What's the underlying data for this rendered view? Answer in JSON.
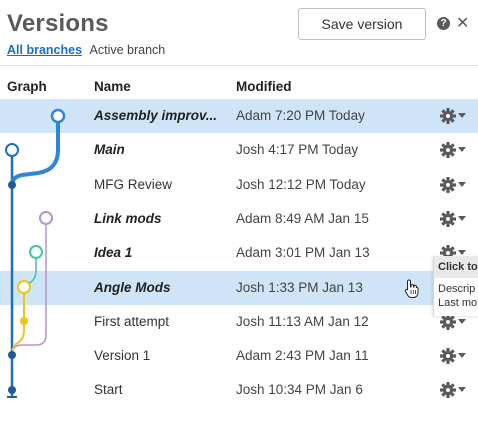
{
  "header": {
    "title": "Versions",
    "save_label": "Save version",
    "help_glyph": "?",
    "close_glyph": "✕"
  },
  "tabs": {
    "all": "All branches",
    "active": "Active branch"
  },
  "columns": {
    "graph": "Graph",
    "name": "Name",
    "modified": "Modified"
  },
  "rows": [
    {
      "name": "Assembly improv...",
      "modified": "Adam 7:20 PM Today",
      "emphasis": true,
      "selected": true
    },
    {
      "name": "Main",
      "modified": "Josh 4:17 PM Today",
      "emphasis": true,
      "selected": false
    },
    {
      "name": "MFG Review",
      "modified": "Josh 12:12 PM Today",
      "emphasis": false,
      "selected": false
    },
    {
      "name": "Link mods",
      "modified": "Adam 8:49 AM Jan 15",
      "emphasis": true,
      "selected": false
    },
    {
      "name": "Idea 1",
      "modified": "Adam 3:01 PM Jan 13",
      "emphasis": true,
      "selected": false
    },
    {
      "name": "Angle Mods",
      "modified": "Josh 1:33 PM Jan 13",
      "emphasis": true,
      "selected": true
    },
    {
      "name": "First attempt",
      "modified": "Josh 11:13 AM Jan 12",
      "emphasis": false,
      "selected": false
    },
    {
      "name": "Version 1",
      "modified": "Adam 2:43 PM Jan 11",
      "emphasis": false,
      "selected": false
    },
    {
      "name": "Start",
      "modified": "Josh 10:34 PM Jan 6",
      "emphasis": false,
      "selected": false
    }
  ],
  "tooltip": {
    "title": "Click to",
    "line1": "Descrip",
    "line2": "Last mo"
  },
  "icons": {
    "row_menu": "gear-icon",
    "cursor": "hand-pointer-icon"
  },
  "colors": {
    "accent": "#1a6fc7",
    "highlight": "#cfe4f6",
    "branch_main": "#1f6fb5",
    "branch_assembly": "#2f86d8",
    "branch_link": "#b892c9",
    "branch_idea": "#3cc9a4",
    "branch_angle": "#f2c417"
  }
}
